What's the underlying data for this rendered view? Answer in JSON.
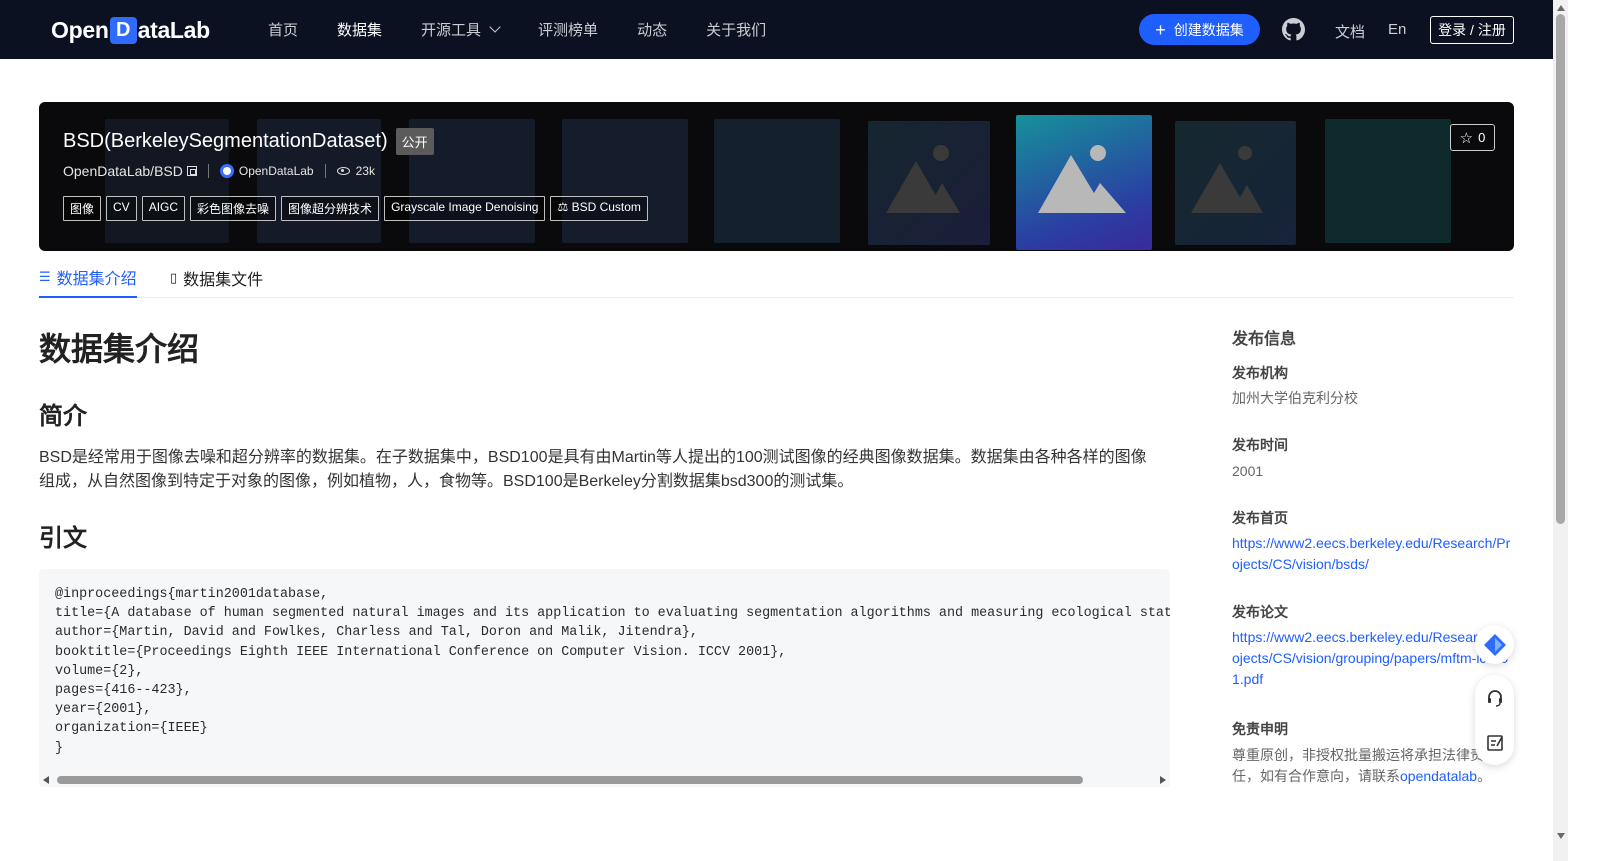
{
  "header": {
    "logo": {
      "pre": "Open",
      "mid": "D",
      "post": "ataLab"
    },
    "nav": [
      "首页",
      "数据集",
      "开源工具",
      "评测榜单",
      "动态",
      "关于我们"
    ],
    "create_label": "创建数据集",
    "docs_label": "文档",
    "lang_label": "En",
    "login_label": "登录 / 注册"
  },
  "dataset": {
    "title": "BSD(BerkeleySegmentationDataset)",
    "visibility": "公开",
    "repo": "OpenDataLab/BSD",
    "org": "OpenDataLab",
    "views": "23k",
    "stars": "0",
    "tags": [
      "图像",
      "CV",
      "AIGC",
      "彩色图像去噪",
      "图像超分辨技术",
      "Grayscale Image Denoising"
    ],
    "license": "BSD Custom"
  },
  "tabs": [
    "数据集介绍",
    "数据集文件"
  ],
  "content": {
    "heading": "数据集介绍",
    "intro_heading": "简介",
    "intro_text": "BSD是经常用于图像去噪和超分辨率的数据集。在子数据集中，BSD100是具有由Martin等人提出的100测试图像的经典图像数据集。数据集由各种各样的图像组成，从自然图像到特定于对象的图像，例如植物，人，食物等。BSD100是Berkeley分割数据集bsd300的测试集。",
    "citation_heading": "引文",
    "citation": "@inproceedings{martin2001database,\ntitle={A database of human segmented natural images and its application to evaluating segmentation algorithms and measuring ecological stati\nauthor={Martin, David and Fowlkes, Charless and Tal, Doron and Malik, Jitendra},\nbooktitle={Proceedings Eighth IEEE International Conference on Computer Vision. ICCV 2001},\nvolume={2},\npages={416--423},\nyear={2001},\norganization={IEEE}\n}"
  },
  "sidebar": {
    "title": "发布信息",
    "org_label": "发布机构",
    "org_value": "加州大学伯克利分校",
    "time_label": "发布时间",
    "time_value": "2001",
    "home_label": "发布首页",
    "home_url": "https://www2.eecs.berkeley.edu/Research/Projects/CS/vision/bsds/",
    "paper_label": "发布论文",
    "paper_url": "https://www2.eecs.berkeley.edu/Research/Projects/CS/vision/grouping/papers/mftm-iccv01.pdf",
    "disclaimer_label": "免责申明",
    "disclaimer_text": "尊重原创，非授权批量搬运将承担法律责任，如有合作意向，请联系",
    "disclaimer_link": "opendatalab",
    "disclaimer_end": "。"
  },
  "colors": {
    "accent": "#1f5eff",
    "topbar": "#0b1120"
  }
}
